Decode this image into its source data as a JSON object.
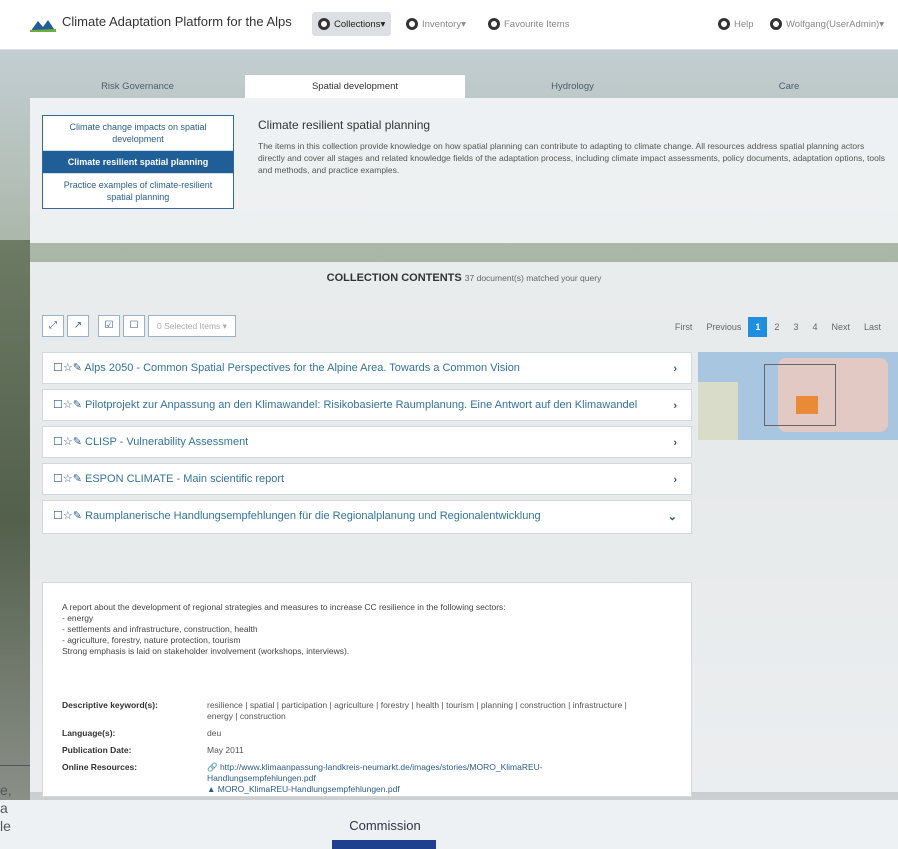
{
  "navbar": {
    "title": "Climate Adaptation Platform for the Alps",
    "buttons": [
      {
        "label": "Collections▾",
        "icon": "collections-icon"
      },
      {
        "label": "Inventory▾",
        "icon": "inventory-icon"
      },
      {
        "label": "Favourite Items",
        "icon": "favourite-icon"
      }
    ],
    "help_label": "Help",
    "user_label": "Wolfgang(UserAdmin)▾"
  },
  "tabs": [
    "Risk Governance",
    "Spatial development",
    "Hydrology",
    "Care"
  ],
  "side_menu": [
    "Climate change impacts on spatial development",
    "Climate resilient spatial planning",
    "Practice examples of climate-resilient spatial planning"
  ],
  "intro": {
    "title": "Climate resilient spatial planning",
    "text": "The items in this collection provide knowledge on how spatial planning can contribute to adapting to climate change. All resources address spatial planning actors directly and cover all stages and related knowledge fields of the adaptation process, including climate impact assessments, policy documents, adaptation options, tools and methods, and practice examples."
  },
  "collection": {
    "title": "COLLECTION CONTENTS",
    "subtitle": "37 document(s) matched your query"
  },
  "toolbar": {
    "selected_label": "0 Selected Items ▾"
  },
  "pager": [
    "First",
    "Previous",
    "1",
    "2",
    "3",
    "4",
    "Next",
    "Last"
  ],
  "documents": [
    {
      "title": "Alps 2050 - Common Spatial Perspectives for the Alpine Area. Towards a Common Vision",
      "chev": "›"
    },
    {
      "title": "Pilotprojekt zur Anpassung an den Klimawandel: Risikobasierte Raumplanung. Eine Antwort auf den Klimawandel",
      "chev": "›"
    },
    {
      "title": "CLISP - Vulnerability Assessment",
      "chev": "›"
    },
    {
      "title": "ESPON CLIMATE - Main scientific report",
      "chev": "›"
    },
    {
      "title": "Raumplanerische Handlungsempfehlungen für die Regionalplanung und Regionalentwicklung",
      "chev": "⌄"
    }
  ],
  "detail": {
    "description": [
      "A report about the development of regional strategies and measures to increase CC resilience in the following sectors:",
      "- energy",
      "- settlements and infrastructure, construction, health",
      "- agriculture, forestry, nature protection, tourism",
      "Strong emphasis is laid on stakeholder involvement (workshops, interviews)."
    ],
    "keywords_label": "Descriptive keyword(s):",
    "keywords": "resilience | spatial | participation | agriculture | forestry | health | tourism | planning | construction | infrastructure | energy | construction",
    "language_label": "Language(s):",
    "language": "deu",
    "pubdate_label": "Publication Date:",
    "pubdate": "May 2011",
    "online_label": "Online Resources:",
    "link1": "http://www.klimaanpassung-landkreis-neumarkt.de/images/stories/MORO_KlimaREU-Handlungsempfehlungen.pdf",
    "link2": "MORO_KlimaREU-Handlungsempfehlungen.pdf"
  },
  "background": {
    "fragments": [
      "e,",
      "a",
      "le"
    ],
    "commission": "Commission"
  },
  "colors": {
    "accent": "#1f5e97",
    "page_active": "#1f8ee0",
    "link": "#33739c"
  }
}
